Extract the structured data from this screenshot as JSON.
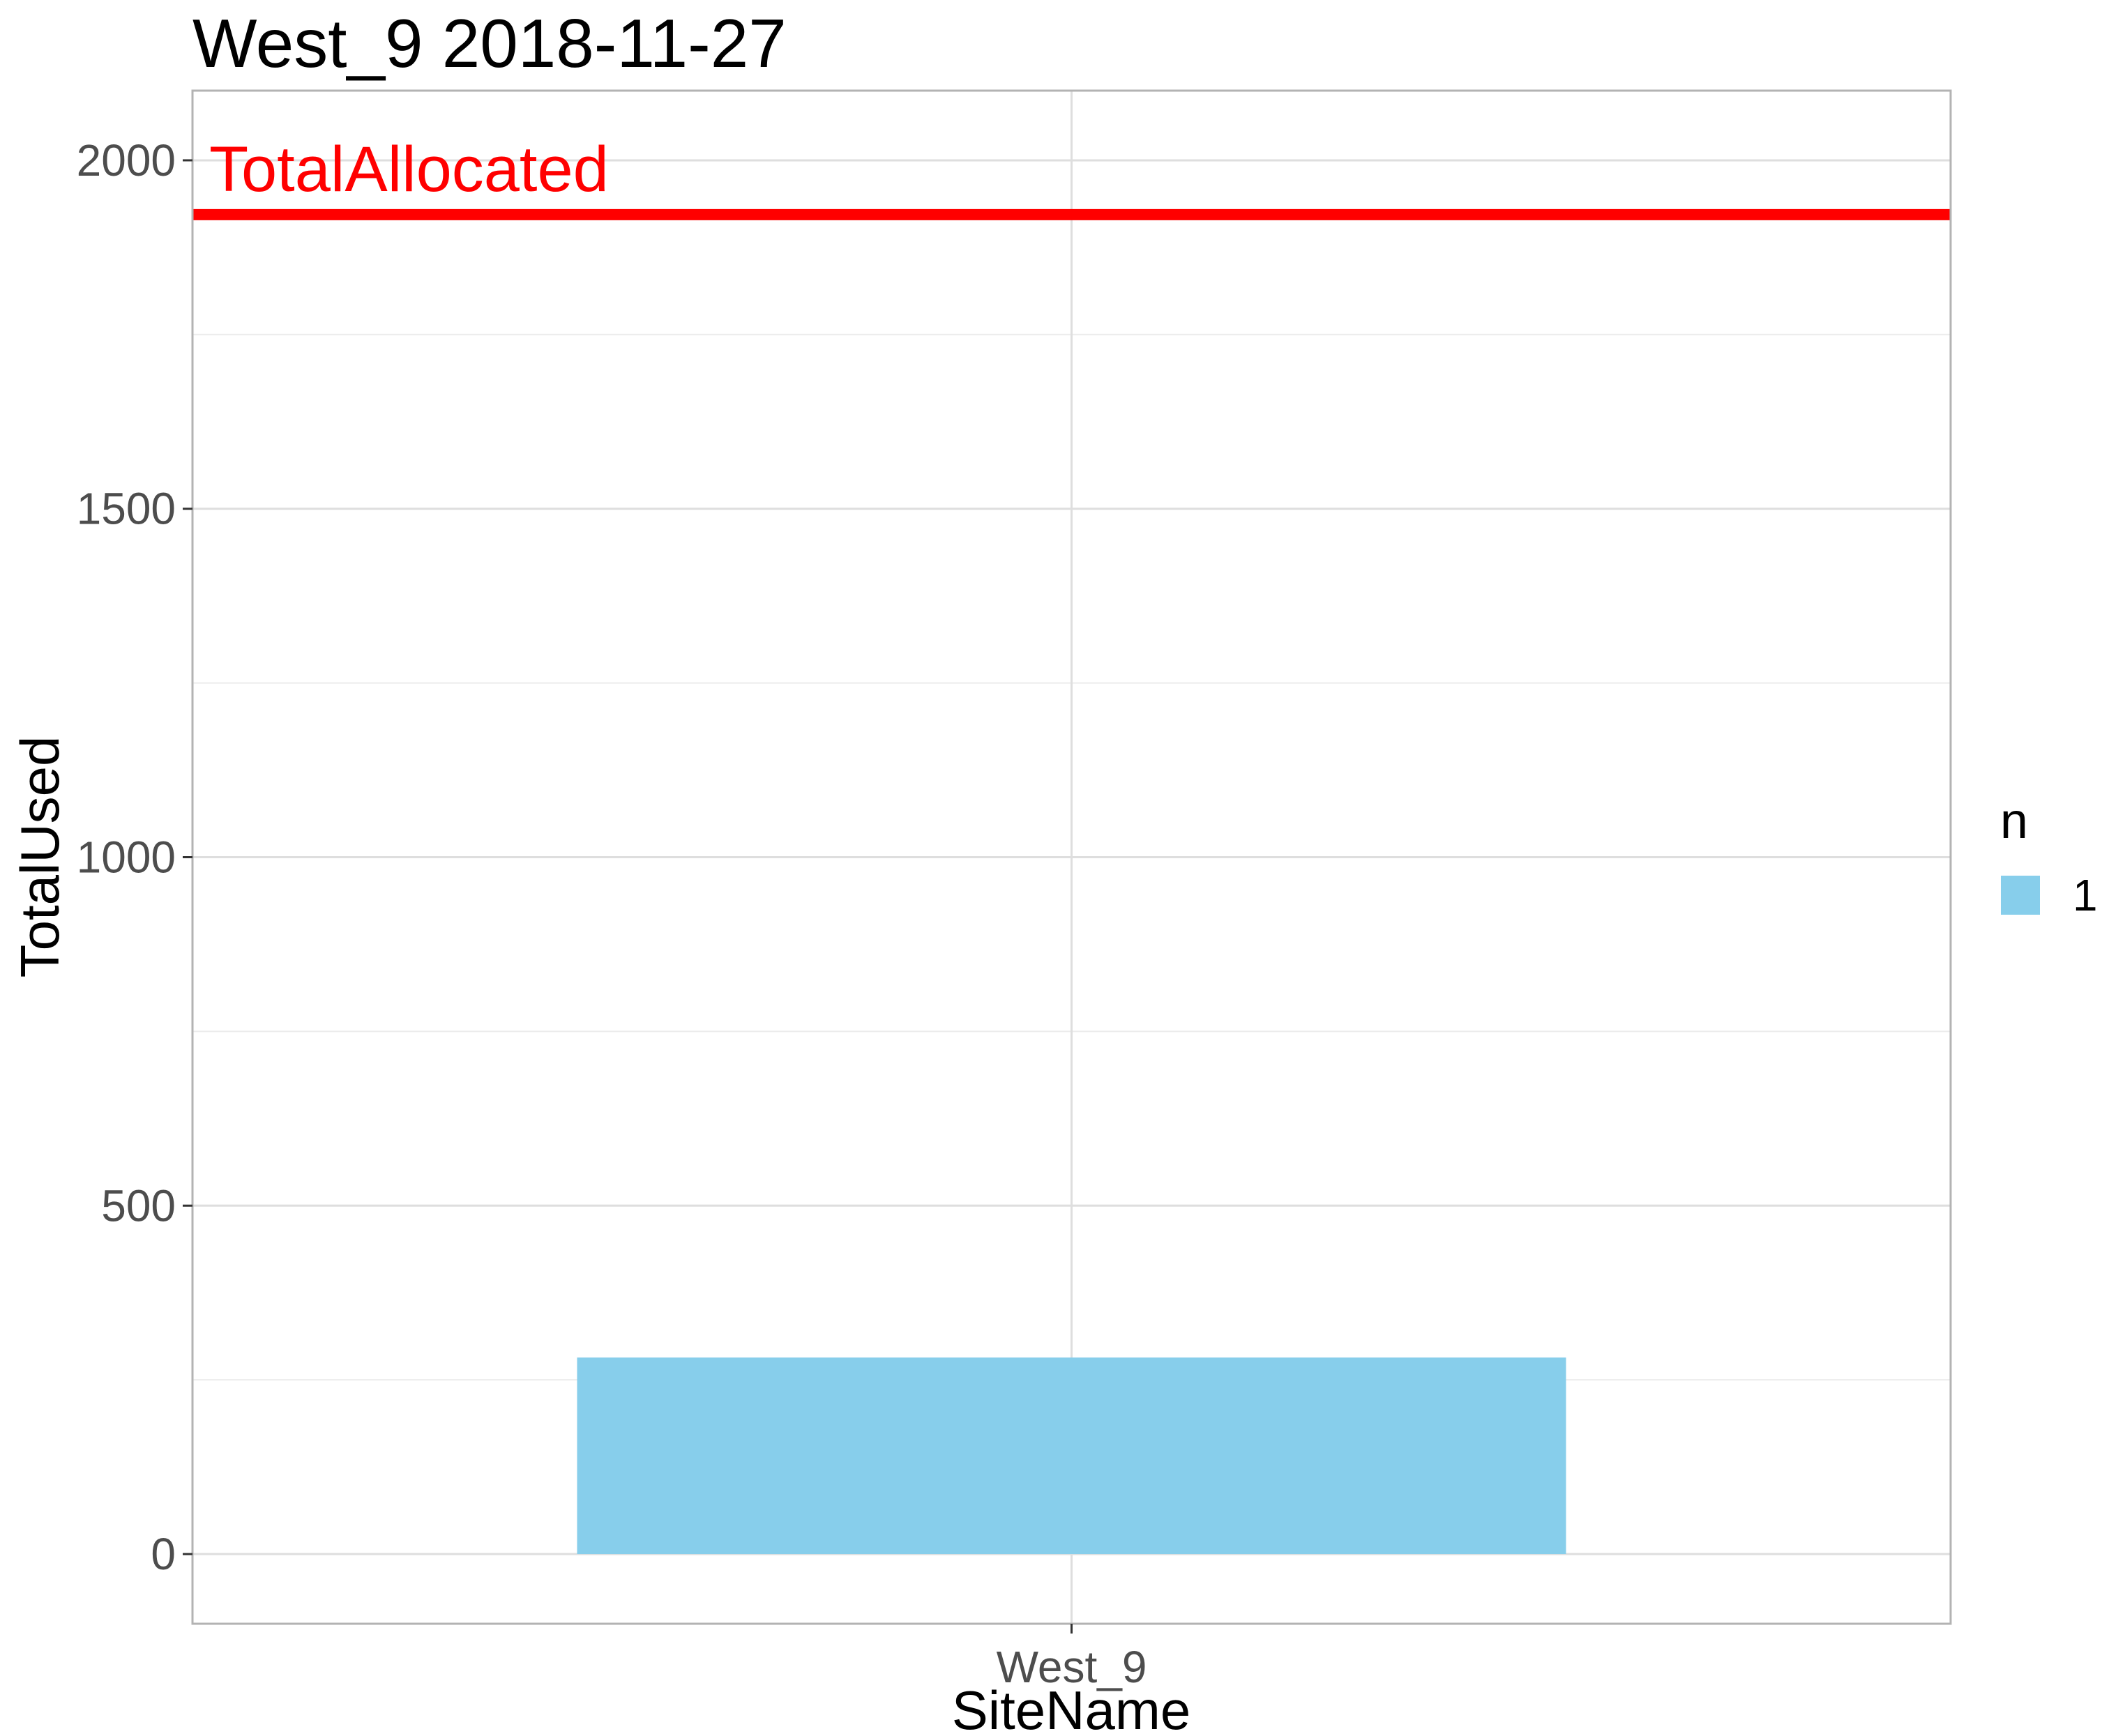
{
  "chart_data": {
    "type": "bar",
    "title": "West_9 2018-11-27",
    "xlabel": "SiteName",
    "ylabel": "TotalUsed",
    "categories": [
      "West_9"
    ],
    "series": [
      {
        "name": "1",
        "values": [
          282
        ],
        "color": "#87CEEB"
      }
    ],
    "ylim": [
      -100,
      2100
    ],
    "yticks": [
      0,
      500,
      1000,
      1500,
      2000
    ],
    "ytick_labels": [
      "0",
      "500",
      "1000",
      "1500",
      "2000"
    ],
    "grid": true,
    "reference_line": {
      "label": "TotalAllocated",
      "value": 1922,
      "color": "#FF0000"
    },
    "legend": {
      "title": "n",
      "position": "right",
      "entries": [
        "1"
      ]
    }
  }
}
